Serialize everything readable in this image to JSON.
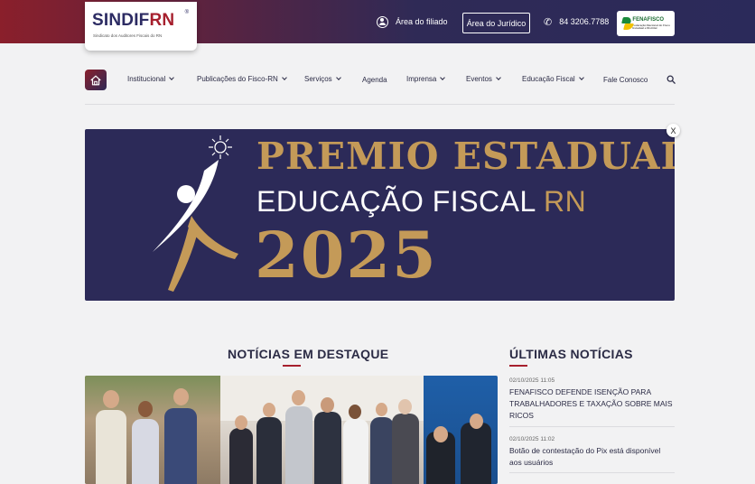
{
  "header": {
    "logo_text_main": "SINDIF",
    "logo_text_accent": "RN",
    "logo_reg": "®",
    "logo_subtitle": "Sindicato dos Auditores Fiscais do RN",
    "area_filiado": "Área do filiado",
    "area_juridico": "Área do Jurídico",
    "phone": "84 3206.7788",
    "fenafisco_label": "FENAFISCO",
    "fenafisco_sub": "Federação Nacional do Fisco Estadual e Distrital"
  },
  "nav": {
    "items": [
      {
        "label": "Institucional",
        "dropdown": true
      },
      {
        "label": "Publicações do Fisco-RN",
        "dropdown": true
      },
      {
        "label": "Serviços",
        "dropdown": true
      },
      {
        "label": "Agenda",
        "dropdown": false
      },
      {
        "label": "Imprensa",
        "dropdown": true
      },
      {
        "label": "Eventos",
        "dropdown": true
      },
      {
        "label": "Educação Fiscal",
        "dropdown": true
      },
      {
        "label": "Fale Conosco",
        "dropdown": false
      }
    ]
  },
  "banner": {
    "close_label": "X",
    "line1": "PREMIO ESTADUAL",
    "line2_white": "EDUCAÇÃO FISCAL ",
    "line2_gold": "RN",
    "line3": "2025"
  },
  "news": {
    "featured_title": "NOTÍCIAS EM DESTAQUE",
    "latest_title": "ÚLTIMAS NOTÍCIAS",
    "latest": [
      {
        "date": "02/10/2025 11:05",
        "title": "FENAFISCO DEFENDE ISENÇÃO PARA TRABALHADORES E TAXAÇÃO SOBRE MAIS RICOS"
      },
      {
        "date": "02/10/2025 11:02",
        "title": "Botão de contestação do Pix está disponível aos usuários"
      }
    ]
  },
  "colors": {
    "brand_red": "#a61f2d",
    "brand_navy": "#2c2a58",
    "banner_gold": "#c49a58"
  }
}
